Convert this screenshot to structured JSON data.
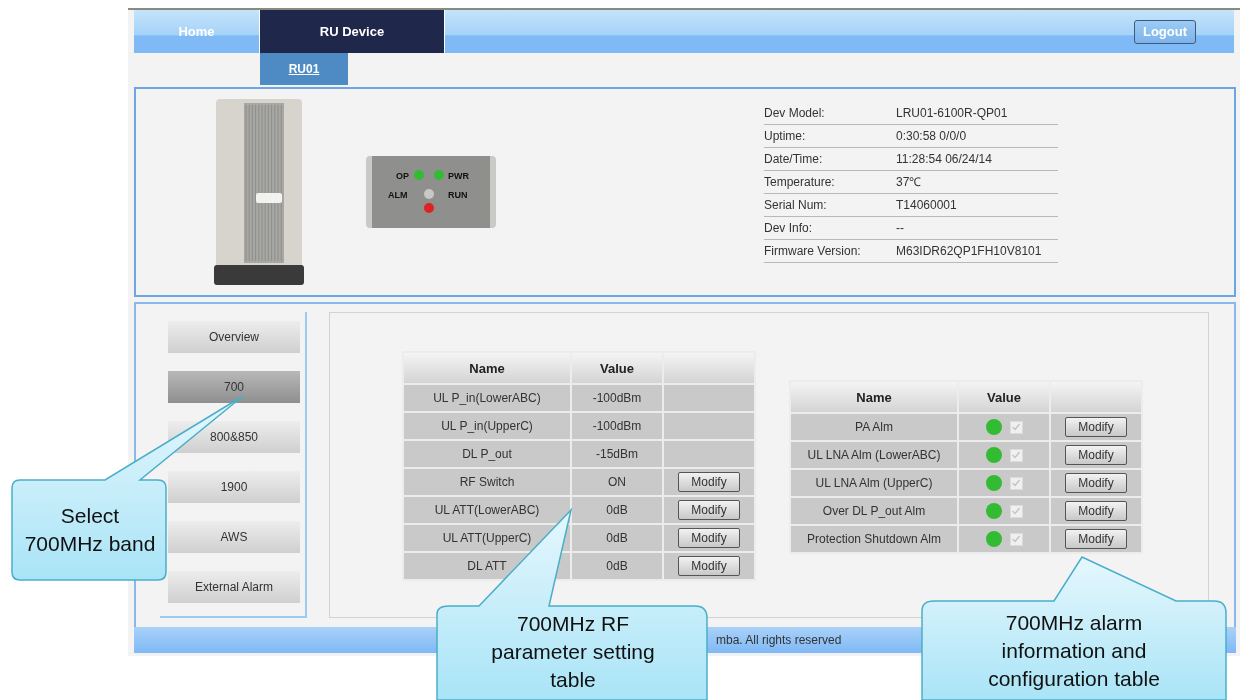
{
  "nav": {
    "tabs": [
      {
        "label": "Home",
        "selected": false
      },
      {
        "label": "RU Device",
        "selected": true
      }
    ],
    "logout": "Logout"
  },
  "subtabs": [
    {
      "label": "RU01",
      "selected": true
    }
  ],
  "led_panel": {
    "labels": [
      "OP",
      "PWR",
      "ALM",
      "RUN"
    ],
    "leds": [
      {
        "color": "#33bb33"
      },
      {
        "color": "#33bb33"
      },
      {
        "color": "#c8c8c8"
      },
      {
        "color": "#dd2222"
      }
    ]
  },
  "device_info": [
    {
      "label": "Dev Model:",
      "value": "LRU01-6100R-QP01"
    },
    {
      "label": "Uptime:",
      "value": "0:30:58 0/0/0"
    },
    {
      "label": "Date/Time:",
      "value": "11:28:54 06/24/14"
    },
    {
      "label": "Temperature:",
      "value": "37℃"
    },
    {
      "label": "Serial Num:",
      "value": "T14060001"
    },
    {
      "label": "Dev Info:",
      "value": "--"
    },
    {
      "label": "Firmware Version:",
      "value": "M63IDR62QP1FH10V8101"
    }
  ],
  "sidebar": {
    "items": [
      {
        "label": "Overview",
        "selected": false
      },
      {
        "label": "700",
        "selected": true
      },
      {
        "label": "800&850",
        "selected": false
      },
      {
        "label": "1900",
        "selected": false
      },
      {
        "label": "AWS",
        "selected": false
      },
      {
        "label": "External Alarm",
        "selected": false
      }
    ]
  },
  "rf_table": {
    "columns": [
      "Name",
      "Value"
    ],
    "rows": [
      {
        "name": "UL P_in(LowerABC)",
        "value": "-100dBm"
      },
      {
        "name": "UL P_in(UpperC)",
        "value": "-100dBm"
      },
      {
        "name": "DL P_out",
        "value": "-15dBm"
      },
      {
        "name": "RF Switch",
        "value": "ON",
        "action": "Modify"
      },
      {
        "name": "UL ATT(LowerABC)",
        "value": "0dB",
        "action": "Modify"
      },
      {
        "name": "UL ATT(UpperC)",
        "value": "0dB",
        "action": "Modify"
      },
      {
        "name": "DL ATT",
        "value": "0dB",
        "action": "Modify"
      }
    ]
  },
  "alarm_table": {
    "columns": [
      "Name",
      "Value"
    ],
    "rows": [
      {
        "name": "PA Alm",
        "color": "#33bb33",
        "checked": true,
        "action": "Modify"
      },
      {
        "name": "UL LNA Alm (LowerABC)",
        "color": "#33bb33",
        "checked": true,
        "action": "Modify"
      },
      {
        "name": "UL LNA Alm (UpperC)",
        "color": "#33bb33",
        "checked": true,
        "action": "Modify"
      },
      {
        "name": "Over DL P_out Alm",
        "color": "#33bb33",
        "checked": true,
        "action": "Modify"
      },
      {
        "name": "Protection Shutdown Alm",
        "color": "#33bb33",
        "checked": true,
        "action": "Modify"
      }
    ]
  },
  "footer": "mba. All rights reserved",
  "callouts": [
    {
      "text": "Select 700MHz band"
    },
    {
      "text": "700MHz RF parameter setting table"
    },
    {
      "text": "700MHz alarm information and configuration table"
    }
  ]
}
